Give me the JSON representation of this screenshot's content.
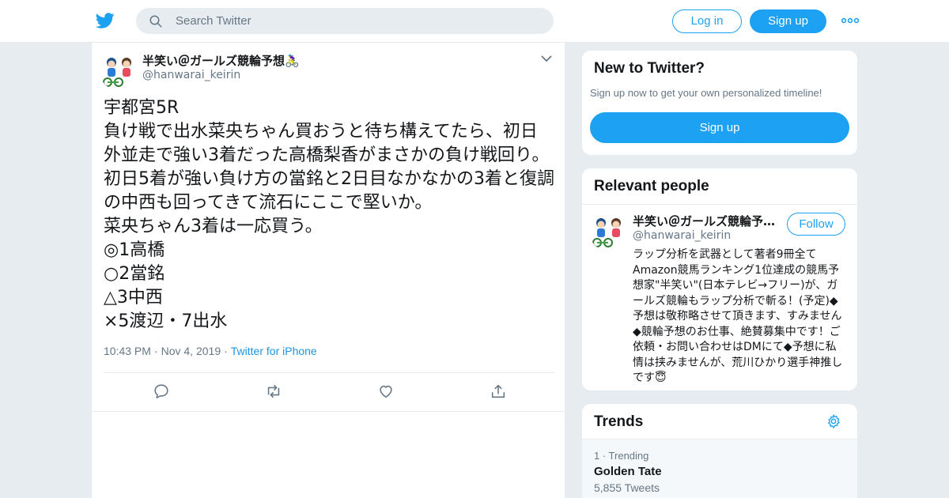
{
  "colors": {
    "accent": "#1da1f2",
    "link": "#1b95e0",
    "muted": "#657786",
    "background": "#e6ecf0"
  },
  "header": {
    "logo_icon": "twitter-bird-icon",
    "search": {
      "placeholder": "Search Twitter",
      "icon": "search-icon"
    },
    "login_label": "Log in",
    "signup_label": "Sign up",
    "more_icon": "more-dots-icon"
  },
  "tweet": {
    "display_name": "半笑い＠ガールズ競輪予想🚴‍♀️",
    "handle": "@hanwarai_keirin",
    "text": "宇都宮5R\n負け戦で出水菜央ちゃん買おうと待ち構えてたら、初日外並走で強い3着だった高橋梨香がまさかの負け戦回り。初日5着が強い負け方の當銘と2日目なかなかの3着と復調の中西も回ってきて流石にここで堅いか。\n菜央ちゃん3着は一応買う。\n◎1高橋\n○2當銘\n△3中西\n×5渡辺・7出水",
    "time": "10:43 PM",
    "date": "Nov 4, 2019",
    "source": "Twitter for iPhone",
    "actions": [
      "reply-icon",
      "retweet-icon",
      "like-icon",
      "share-icon"
    ]
  },
  "new_to_twitter": {
    "title": "New to Twitter?",
    "subtitle": "Sign up now to get your own personalized timeline!",
    "signup_label": "Sign up"
  },
  "relevant_people": {
    "title": "Relevant people",
    "person": {
      "name": "半笑い＠ガールズ競輪予…",
      "handle": "@hanwarai_keirin",
      "follow_label": "Follow",
      "bio": "ラップ分析を武器として著者9冊全てAmazon競馬ランキング1位達成の競馬予想家\"半笑い\"(日本テレビ→フリー)が、ガールズ競輪もラップ分析で斬る！(予定)◆予想は敬称略させて頂きます、すみません◆競輪予想のお仕事、絶賛募集中です！ご依頼・お問い合わせはDMにて◆予想に私情は挟みませんが、荒川ひかり選手神推しです😇"
    }
  },
  "trends": {
    "title": "Trends",
    "settings_icon": "gear-icon",
    "items": [
      {
        "rank_label": "1 · Trending",
        "topic": "Golden Tate",
        "count": "5,855 Tweets"
      }
    ]
  }
}
